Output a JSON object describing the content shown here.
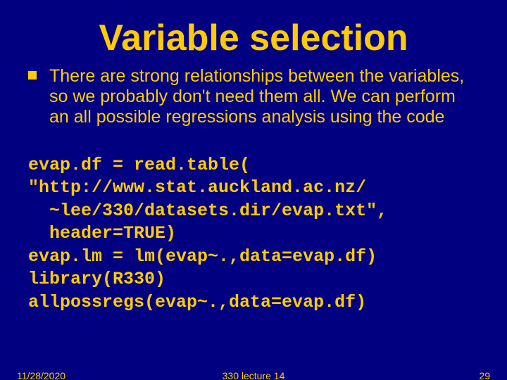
{
  "title": "Variable selection",
  "bullet_text": "There are strong relationships between the variables, so we probably don't need them all. We can perform an all possible regressions analysis using the code",
  "code_lines": [
    "evap.df = read.table(",
    "\"http://www.stat.auckland.ac.nz/",
    "  ~lee/330/datasets.dir/evap.txt\",",
    "  header=TRUE)",
    "evap.lm = lm(evap~.,data=evap.df)",
    "library(R330)",
    "allpossregs(evap~.,data=evap.df)"
  ],
  "footer": {
    "date": "11/28/2020",
    "center": "330 lecture 14",
    "page": "29"
  }
}
